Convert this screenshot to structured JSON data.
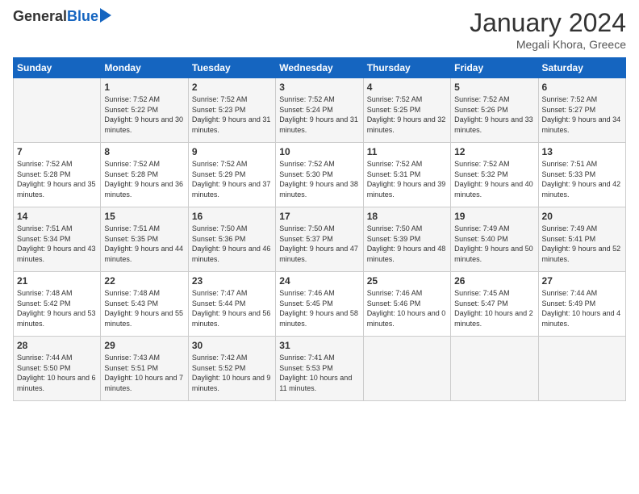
{
  "header": {
    "logo_general": "General",
    "logo_blue": "Blue",
    "title": "January 2024",
    "subtitle": "Megali Khora, Greece"
  },
  "days_of_week": [
    "Sunday",
    "Monday",
    "Tuesday",
    "Wednesday",
    "Thursday",
    "Friday",
    "Saturday"
  ],
  "weeks": [
    [
      {
        "day": "",
        "sunrise": "",
        "sunset": "",
        "daylight": ""
      },
      {
        "day": "1",
        "sunrise": "7:52 AM",
        "sunset": "5:22 PM",
        "daylight": "9 hours and 30 minutes."
      },
      {
        "day": "2",
        "sunrise": "7:52 AM",
        "sunset": "5:23 PM",
        "daylight": "9 hours and 31 minutes."
      },
      {
        "day": "3",
        "sunrise": "7:52 AM",
        "sunset": "5:24 PM",
        "daylight": "9 hours and 31 minutes."
      },
      {
        "day": "4",
        "sunrise": "7:52 AM",
        "sunset": "5:25 PM",
        "daylight": "9 hours and 32 minutes."
      },
      {
        "day": "5",
        "sunrise": "7:52 AM",
        "sunset": "5:26 PM",
        "daylight": "9 hours and 33 minutes."
      },
      {
        "day": "6",
        "sunrise": "7:52 AM",
        "sunset": "5:27 PM",
        "daylight": "9 hours and 34 minutes."
      }
    ],
    [
      {
        "day": "7",
        "sunrise": "7:52 AM",
        "sunset": "5:28 PM",
        "daylight": "9 hours and 35 minutes."
      },
      {
        "day": "8",
        "sunrise": "7:52 AM",
        "sunset": "5:28 PM",
        "daylight": "9 hours and 36 minutes."
      },
      {
        "day": "9",
        "sunrise": "7:52 AM",
        "sunset": "5:29 PM",
        "daylight": "9 hours and 37 minutes."
      },
      {
        "day": "10",
        "sunrise": "7:52 AM",
        "sunset": "5:30 PM",
        "daylight": "9 hours and 38 minutes."
      },
      {
        "day": "11",
        "sunrise": "7:52 AM",
        "sunset": "5:31 PM",
        "daylight": "9 hours and 39 minutes."
      },
      {
        "day": "12",
        "sunrise": "7:52 AM",
        "sunset": "5:32 PM",
        "daylight": "9 hours and 40 minutes."
      },
      {
        "day": "13",
        "sunrise": "7:51 AM",
        "sunset": "5:33 PM",
        "daylight": "9 hours and 42 minutes."
      }
    ],
    [
      {
        "day": "14",
        "sunrise": "7:51 AM",
        "sunset": "5:34 PM",
        "daylight": "9 hours and 43 minutes."
      },
      {
        "day": "15",
        "sunrise": "7:51 AM",
        "sunset": "5:35 PM",
        "daylight": "9 hours and 44 minutes."
      },
      {
        "day": "16",
        "sunrise": "7:50 AM",
        "sunset": "5:36 PM",
        "daylight": "9 hours and 46 minutes."
      },
      {
        "day": "17",
        "sunrise": "7:50 AM",
        "sunset": "5:37 PM",
        "daylight": "9 hours and 47 minutes."
      },
      {
        "day": "18",
        "sunrise": "7:50 AM",
        "sunset": "5:39 PM",
        "daylight": "9 hours and 48 minutes."
      },
      {
        "day": "19",
        "sunrise": "7:49 AM",
        "sunset": "5:40 PM",
        "daylight": "9 hours and 50 minutes."
      },
      {
        "day": "20",
        "sunrise": "7:49 AM",
        "sunset": "5:41 PM",
        "daylight": "9 hours and 52 minutes."
      }
    ],
    [
      {
        "day": "21",
        "sunrise": "7:48 AM",
        "sunset": "5:42 PM",
        "daylight": "9 hours and 53 minutes."
      },
      {
        "day": "22",
        "sunrise": "7:48 AM",
        "sunset": "5:43 PM",
        "daylight": "9 hours and 55 minutes."
      },
      {
        "day": "23",
        "sunrise": "7:47 AM",
        "sunset": "5:44 PM",
        "daylight": "9 hours and 56 minutes."
      },
      {
        "day": "24",
        "sunrise": "7:46 AM",
        "sunset": "5:45 PM",
        "daylight": "9 hours and 58 minutes."
      },
      {
        "day": "25",
        "sunrise": "7:46 AM",
        "sunset": "5:46 PM",
        "daylight": "10 hours and 0 minutes."
      },
      {
        "day": "26",
        "sunrise": "7:45 AM",
        "sunset": "5:47 PM",
        "daylight": "10 hours and 2 minutes."
      },
      {
        "day": "27",
        "sunrise": "7:44 AM",
        "sunset": "5:49 PM",
        "daylight": "10 hours and 4 minutes."
      }
    ],
    [
      {
        "day": "28",
        "sunrise": "7:44 AM",
        "sunset": "5:50 PM",
        "daylight": "10 hours and 6 minutes."
      },
      {
        "day": "29",
        "sunrise": "7:43 AM",
        "sunset": "5:51 PM",
        "daylight": "10 hours and 7 minutes."
      },
      {
        "day": "30",
        "sunrise": "7:42 AM",
        "sunset": "5:52 PM",
        "daylight": "10 hours and 9 minutes."
      },
      {
        "day": "31",
        "sunrise": "7:41 AM",
        "sunset": "5:53 PM",
        "daylight": "10 hours and 11 minutes."
      },
      {
        "day": "",
        "sunrise": "",
        "sunset": "",
        "daylight": ""
      },
      {
        "day": "",
        "sunrise": "",
        "sunset": "",
        "daylight": ""
      },
      {
        "day": "",
        "sunrise": "",
        "sunset": "",
        "daylight": ""
      }
    ]
  ]
}
